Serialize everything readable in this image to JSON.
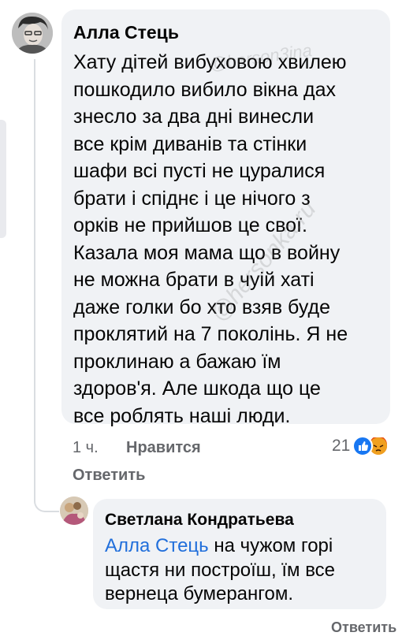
{
  "comment": {
    "author": "Алла Стець",
    "lines": [
      "Хату дітей вибуховою хвилею",
      "пошкодило вибило вікна дах",
      "знесло за два дні винесли",
      "все крім диванів та стінки",
      "шафи всі пусті не цуралися",
      "брати і спіднє і це нічого з",
      "орків не прийшов це свої.",
      "Казала моя мама що в войну",
      "не можна брати в чуій хаті",
      "даже голки бо хто взяв буде",
      "проклятий на 7 поколінь. Я не",
      "проклинаю а бажаю їм",
      "здоров'я. Але шкода що це",
      "все роблять наші люди."
    ],
    "time": "1 ч.",
    "like_label": "Нравится",
    "reply_label": "Ответить",
    "reaction_count": "21",
    "reaction_icons": [
      "like-icon",
      "angry-icon"
    ],
    "colors": {
      "like": "#1877f2",
      "angry": "#e9710f",
      "mention": "#216fdb"
    }
  },
  "reply": {
    "author": "Светлана Кондратьева",
    "mention": "Алла Стець",
    "line1_rest": " на чужом  горі",
    "line2": "щастя ни построїш, їм  все",
    "line3": "вернеца бумерангом."
  },
  "watermark": {
    "top": "@berson3ina",
    "diagonal": "@hersonka.ru"
  },
  "footer_cut": "Ответить"
}
